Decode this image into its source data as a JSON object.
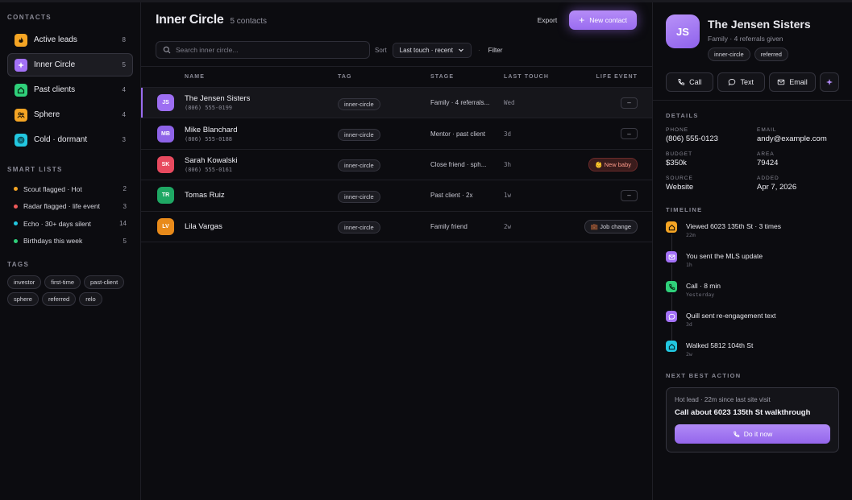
{
  "sidebar": {
    "contacts_label": "CONTACTS",
    "items": [
      {
        "label": "Active leads",
        "count": "8",
        "icon": "flame-icon",
        "color": "#f5a524"
      },
      {
        "label": "Inner Circle",
        "count": "5",
        "icon": "sparkle-icon",
        "color": "#a371f7"
      },
      {
        "label": "Past clients",
        "count": "4",
        "icon": "home-icon",
        "color": "#2fd07a"
      },
      {
        "label": "Sphere",
        "count": "4",
        "icon": "users-icon",
        "color": "#f5a524"
      },
      {
        "label": "Cold · dormant",
        "count": "3",
        "icon": "target-icon",
        "color": "#22c7e0"
      }
    ],
    "smart_label": "SMART LISTS",
    "smart_lists": [
      {
        "label": "Scout flagged · Hot",
        "count": "2",
        "color": "#f5a524"
      },
      {
        "label": "Radar flagged · life event",
        "count": "3",
        "color": "#ef5a5a"
      },
      {
        "label": "Echo · 30+ days silent",
        "count": "14",
        "color": "#22c7e0"
      },
      {
        "label": "Birthdays this week",
        "count": "5",
        "color": "#2fd07a"
      }
    ],
    "tags_label": "TAGS",
    "tags": [
      "investor",
      "first-time",
      "past-client",
      "sphere",
      "referred",
      "relo"
    ]
  },
  "main": {
    "title": "Inner Circle",
    "count": "5 contacts",
    "export_label": "Export",
    "new_contact_label": "New contact",
    "search_placeholder": "Search inner circle...",
    "sort_label": "Sort",
    "sort_value": "Last touch · recent",
    "separator": "·",
    "filter_label": "Filter",
    "columns": {
      "name": "NAME",
      "tag": "TAG",
      "stage": "STAGE",
      "touch": "LAST TOUCH",
      "life": "LIFE EVENT"
    },
    "rows": [
      {
        "initials": "JS",
        "name": "The Jensen Sisters",
        "phone": "(806) 555-0199",
        "tag": "inner-circle",
        "stage": "Family · 4 referrals...",
        "touch": "Wed",
        "life": "–",
        "color": "#9d6ef2"
      },
      {
        "initials": "MB",
        "name": "Mike Blanchard",
        "phone": "(806) 555-0188",
        "tag": "inner-circle",
        "stage": "Mentor · past client",
        "touch": "3d",
        "life": "–",
        "color": "#8e63e8"
      },
      {
        "initials": "SK",
        "name": "Sarah Kowalski",
        "phone": "(806) 555-0161",
        "tag": "inner-circle",
        "stage": "Close friend · sph...",
        "touch": "3h",
        "life": "👶 New baby",
        "color": "#e84a5f"
      },
      {
        "initials": "TR",
        "name": "Tomas Ruiz",
        "phone": "",
        "tag": "inner-circle",
        "stage": "Past client · 2x",
        "touch": "1w",
        "life": "–",
        "color": "#1fa864"
      },
      {
        "initials": "LV",
        "name": "Lila Vargas",
        "phone": "",
        "tag": "inner-circle",
        "stage": "Family friend",
        "touch": "2w",
        "life": "💼 Job change",
        "color": "#e88a1a"
      }
    ]
  },
  "panel": {
    "initials": "JS",
    "name": "The Jensen Sisters",
    "subtitle": "Family · 4 referrals given",
    "chips": [
      "inner-circle",
      "referred"
    ],
    "actions": {
      "call": "Call",
      "text": "Text",
      "email": "Email"
    },
    "details_label": "DETAILS",
    "details": [
      {
        "key": "PHONE",
        "value": "(806) 555-0123"
      },
      {
        "key": "EMAIL",
        "value": "andy@example.com"
      },
      {
        "key": "BUDGET",
        "value": "$350k"
      },
      {
        "key": "AREA",
        "value": "79424"
      },
      {
        "key": "SOURCE",
        "value": "Website"
      },
      {
        "key": "ADDED",
        "value": "Apr 7, 2026"
      }
    ],
    "timeline_label": "TIMELINE",
    "timeline": [
      {
        "text": "Viewed 6023 135th St · 3 times",
        "time": "22m",
        "icon": "home-icon",
        "color": "#f5a524"
      },
      {
        "text": "You sent the MLS update",
        "time": "1h",
        "icon": "mail-icon",
        "color": "#a371f7"
      },
      {
        "text": "Call · 8 min",
        "time": "Yesterday",
        "icon": "phone-icon",
        "color": "#2fd07a"
      },
      {
        "text": "Quill sent re-engagement text",
        "time": "3d",
        "icon": "chat-icon",
        "color": "#a371f7"
      },
      {
        "text": "Walked 5812 104th St",
        "time": "2w",
        "icon": "home-icon",
        "color": "#22c7e0"
      }
    ],
    "nba_label": "NEXT BEST ACTION",
    "nba": {
      "subtitle": "Hot lead · 22m since last site visit",
      "title": "Call about 6023 135th St walkthrough",
      "button": "Do it now"
    }
  }
}
